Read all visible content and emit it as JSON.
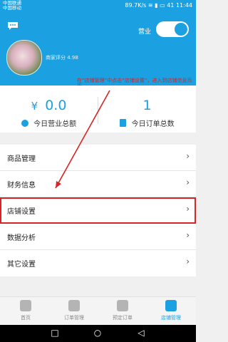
{
  "status_bar": {
    "carrier_1": "中国联通",
    "carrier_2": "中国移动",
    "speed": "89.7K/s",
    "battery": "41",
    "time": "11:44"
  },
  "header": {
    "business_label": "营业",
    "rating": "商家评分 4.98",
    "toggle_on": true
  },
  "annotation": {
    "text": "在“店铺管理”中点击“店铺设置”，进入到店铺信息页面"
  },
  "stats": {
    "revenue_value": "0.0",
    "revenue_label": "今日营业总额",
    "orders_value": "1",
    "orders_label": "今日订单总数",
    "currency_symbol": "¥"
  },
  "menu": {
    "items": [
      {
        "label": "商品管理"
      },
      {
        "label": "财务信息"
      },
      {
        "label": "店铺设置"
      },
      {
        "label": "数据分析"
      },
      {
        "label": "其它设置"
      }
    ],
    "chevron": "›"
  },
  "bottom_nav": {
    "items": [
      {
        "label": "首页"
      },
      {
        "label": "订单管理"
      },
      {
        "label": "预定订单"
      },
      {
        "label": "店铺管理"
      }
    ]
  },
  "android_nav": {
    "recent": "□",
    "home": "○",
    "back": "◁"
  },
  "colors": {
    "accent": "#1ba1e2",
    "annotation": "#d72424"
  }
}
